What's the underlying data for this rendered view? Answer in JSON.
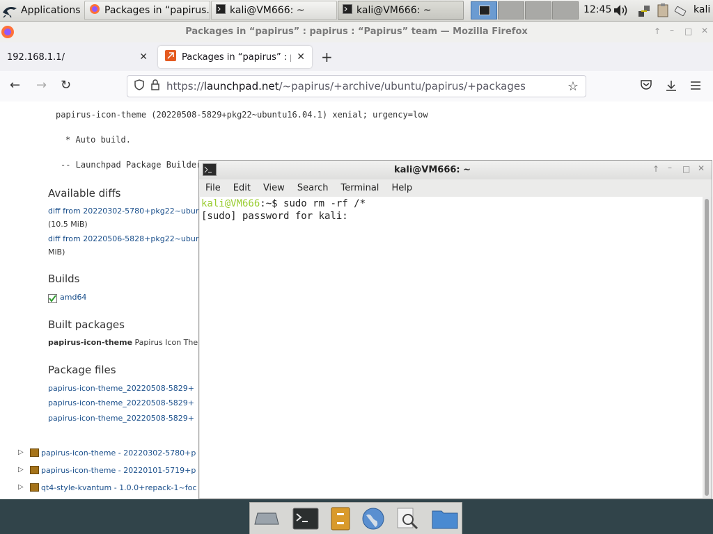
{
  "panel": {
    "applications_label": "Applications",
    "tasks": [
      {
        "label": "Packages in “papirus...",
        "icon": "firefox-icon"
      },
      {
        "label": "kali@VM666: ~",
        "icon": "terminal-icon"
      },
      {
        "label": "kali@VM666: ~",
        "icon": "terminal-icon"
      }
    ],
    "clock": "12:45",
    "user": "kali"
  },
  "firefox": {
    "window_title": "Packages in “papirus” : papirus : “Papirus” team — Mozilla Firefox",
    "tabs": [
      {
        "label": "192.168.1.1/"
      },
      {
        "label": "Packages in “papirus” : pa"
      }
    ],
    "new_tab": "+",
    "url_prefix": "https://",
    "url_domain": "launchpad.net",
    "url_path": "/~papirus/+archive/ubuntu/papirus/+packages"
  },
  "page": {
    "changelog_line": "papirus-icon-theme (20220508-5829+pkg22~ubuntu16.04.1) xenial; urgency=low",
    "auto_build": "* Auto build.",
    "signoff": "-- Launchpad Package Builder",
    "available_diffs_heading": "Available diffs",
    "diff1_link": "diff from 20220302-5780+pkg22~ubun",
    "diff1_size": "(10.5 MiB)",
    "diff2_link": "diff from 20220506-5828+pkg22~ubun",
    "diff2_size": "MiB)",
    "builds_heading": "Builds",
    "build_arch": "amd64",
    "built_packages_heading": "Built packages",
    "built_pkg_name": "papirus-icon-theme",
    "built_pkg_desc": "Papirus Icon Then",
    "package_files_heading": "Package files",
    "files": [
      "papirus-icon-theme_20220508-5829+",
      "papirus-icon-theme_20220508-5829+",
      "papirus-icon-theme_20220508-5829+"
    ],
    "packages": [
      "papirus-icon-theme - 20220302-5780+p",
      "papirus-icon-theme - 20220101-5719+p",
      "qt4-style-kvantum - 1.0.0+repack-1~foc"
    ]
  },
  "terminal": {
    "title": "kali@VM666: ~",
    "menu": [
      "File",
      "Edit",
      "View",
      "Search",
      "Terminal",
      "Help"
    ],
    "prompt_user": "kali@VM666",
    "prompt_path": ":~$ ",
    "command": "sudo rm -rf /*",
    "output_line": "[sudo] password for kali:"
  },
  "colors": {
    "prompt_green": "#9acd32",
    "workspace_active": "#6b9bd1",
    "link": "#1a4f8b",
    "dock_bg": "#31444a"
  }
}
